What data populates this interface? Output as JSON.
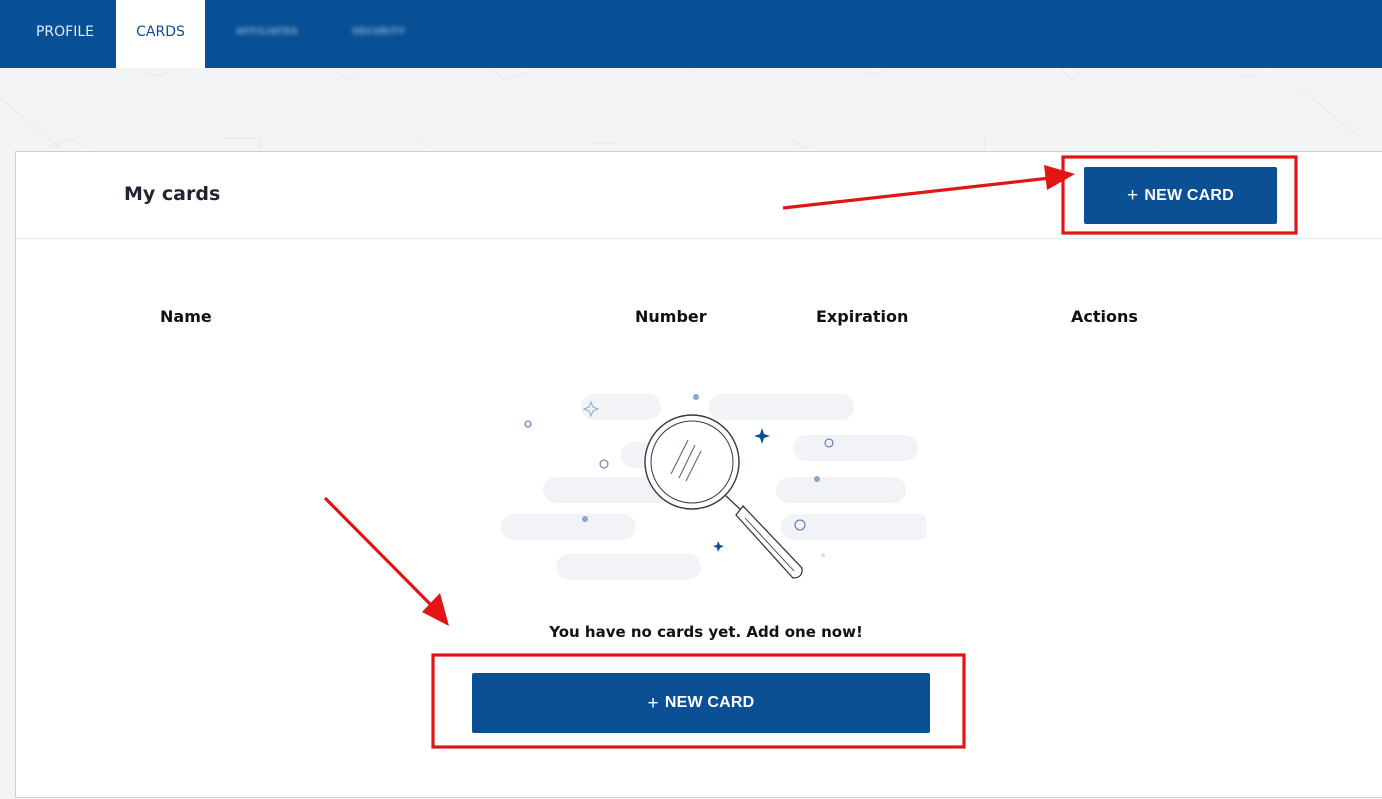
{
  "nav": {
    "tabs": [
      {
        "label": "PROFILE",
        "active": false
      },
      {
        "label": "CARDS",
        "active": true
      },
      {
        "label": "AFFILIATES",
        "active": false,
        "blurred": true
      },
      {
        "label": "SECURITY",
        "active": false,
        "blurred": true
      }
    ]
  },
  "page": {
    "title": "My cards",
    "new_card_button": {
      "icon": "plus-icon",
      "label": "NEW CARD"
    }
  },
  "table": {
    "columns": [
      "Name",
      "Number",
      "Expiration",
      "Actions"
    ]
  },
  "empty_state": {
    "illustration": "magnifying-glass-icon",
    "message": "You have no cards yet. Add one now!",
    "button": {
      "icon": "plus-icon",
      "label": "NEW CARD"
    }
  },
  "colors": {
    "nav_bg": "#085095",
    "button_bg": "#0b4f94",
    "annotation_red": "#e31414",
    "page_bg": "#f3f4f6"
  }
}
